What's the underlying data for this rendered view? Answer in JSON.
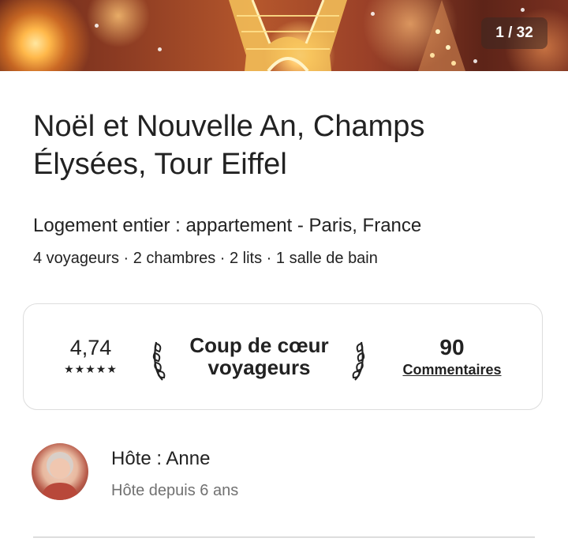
{
  "gallery": {
    "counter": "1 / 32"
  },
  "listing": {
    "title": "Noël et Nouvelle An, Champs Élysées, Tour Eiffel",
    "subtitle": "Logement entier : appartement - Paris, France",
    "details": "4 voyageurs · 2 chambres · 2 lits · 1 salle de bain"
  },
  "rating_card": {
    "rating": "4,74",
    "stars": "★★★★★",
    "star_count": 5,
    "guest_favorite_line1": "Coup de cœur",
    "guest_favorite_line2": "voyageurs",
    "reviews_count": "90",
    "reviews_label": "Commentaires"
  },
  "host": {
    "name_label": "Hôte : Anne",
    "since": "Hôte depuis 6 ans"
  },
  "icons": [
    "star-icon",
    "laurel-left-icon",
    "laurel-right-icon"
  ],
  "colors": {
    "text": "#222222",
    "muted": "#717171",
    "border": "#dddddd"
  }
}
